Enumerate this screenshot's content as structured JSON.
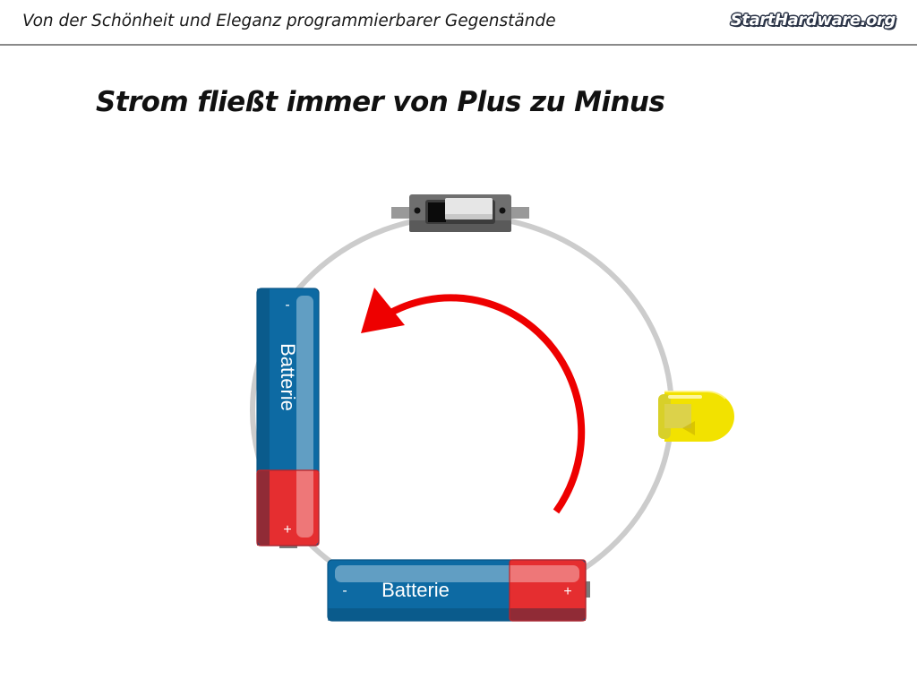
{
  "header": {
    "title": "Von der Schönheit und Eleganz programmierbarer Gegenstände",
    "logo_text": "StartHardware.org"
  },
  "slide": {
    "title": "Strom fließt immer von Plus zu Minus"
  },
  "diagram": {
    "battery_left": {
      "label": "Batterie",
      "minus_sign": "-",
      "plus_sign": "+"
    },
    "battery_bottom": {
      "label": "Batterie",
      "minus_sign": "-",
      "plus_sign": "+"
    },
    "switch_icon": "slide-switch-icon",
    "led_icon": "yellow-led-icon",
    "arrow_icon": "current-flow-arrow-icon"
  },
  "colors": {
    "wire": "#cccccc",
    "arrow": "#ee0000",
    "battery_blue": "#0d6aa3",
    "battery_red": "#e52e30",
    "led_yellow": "#f2e200"
  }
}
